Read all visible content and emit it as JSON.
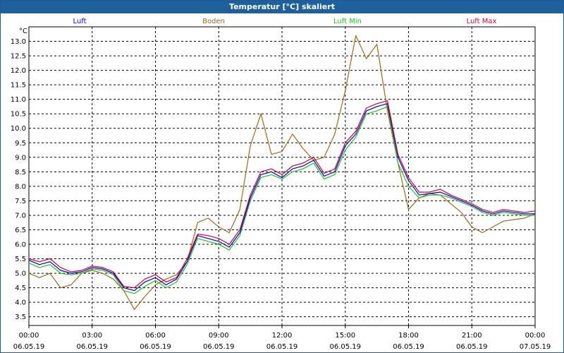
{
  "window": {
    "title": "Temperatur [°C] skaliert"
  },
  "chart_data": {
    "type": "line",
    "title": "Temperatur [°C] skaliert",
    "ylabel": "°C",
    "xlabel": "",
    "ylim": [
      3.2,
      13.5
    ],
    "xlim": [
      0,
      24
    ],
    "yticks": [
      "3.5",
      "4.0",
      "4.5",
      "5.0",
      "5.5",
      "6.0",
      "6.5",
      "7.0",
      "7.5",
      "8.0",
      "8.5",
      "9.0",
      "9.5",
      "10.0",
      "10.5",
      "11.0",
      "11.5",
      "12.0",
      "12.5",
      "13.0"
    ],
    "xticks": [
      {
        "time": "00:00",
        "date": "06.05.19"
      },
      {
        "time": "03:00",
        "date": "06.05.19"
      },
      {
        "time": "06:00",
        "date": "06.05.19"
      },
      {
        "time": "09:00",
        "date": "06.05.19"
      },
      {
        "time": "12:00",
        "date": "06.05.19"
      },
      {
        "time": "15:00",
        "date": "06.05.19"
      },
      {
        "time": "18:00",
        "date": "06.05.19"
      },
      {
        "time": "21:00",
        "date": "06.05.19"
      },
      {
        "time": "00:00",
        "date": "07.05.19"
      }
    ],
    "grid": true,
    "legend_position": "top",
    "series": [
      {
        "name": "Luft",
        "color": "#0000cc",
        "x": [
          0,
          0.5,
          1,
          1.5,
          2,
          2.5,
          3,
          3.5,
          4,
          4.5,
          5,
          5.5,
          6,
          6.5,
          7,
          7.5,
          8,
          8.5,
          9,
          9.5,
          10,
          10.5,
          11,
          11.5,
          12,
          12.5,
          13,
          13.5,
          14,
          14.5,
          15,
          15.5,
          16,
          16.5,
          17,
          17.5,
          18,
          18.5,
          19,
          19.5,
          20,
          20.5,
          21,
          21.5,
          22,
          22.5,
          23,
          23.5,
          24
        ],
        "y": [
          5.45,
          5.3,
          5.4,
          5.1,
          5.0,
          5.05,
          5.2,
          5.15,
          5.0,
          4.5,
          4.4,
          4.7,
          4.85,
          4.6,
          4.8,
          5.4,
          6.3,
          6.2,
          6.1,
          5.9,
          6.4,
          7.6,
          8.4,
          8.5,
          8.3,
          8.6,
          8.7,
          8.9,
          8.35,
          8.5,
          9.4,
          9.8,
          10.6,
          10.75,
          10.85,
          9.0,
          8.2,
          7.7,
          7.75,
          7.8,
          7.65,
          7.5,
          7.35,
          7.15,
          7.05,
          7.15,
          7.1,
          7.05,
          7.05
        ]
      },
      {
        "name": "Boden",
        "color": "#a0661a",
        "x": [
          0,
          0.5,
          1,
          1.5,
          2,
          2.5,
          3,
          3.5,
          4,
          4.5,
          5,
          5.5,
          6,
          6.5,
          7,
          7.5,
          8,
          8.5,
          9,
          9.5,
          10,
          10.5,
          11,
          11.5,
          12,
          12.5,
          13,
          13.5,
          14,
          14.5,
          15,
          15.5,
          16,
          16.5,
          17,
          17.5,
          18,
          18.5,
          19,
          19.5,
          20,
          20.5,
          21,
          21.5,
          22,
          22.5,
          23,
          23.5,
          24
        ],
        "y": [
          5.0,
          4.85,
          5.0,
          4.5,
          4.6,
          5.0,
          5.1,
          5.0,
          4.8,
          4.4,
          3.75,
          4.2,
          4.6,
          4.8,
          4.95,
          5.4,
          6.75,
          6.9,
          6.6,
          6.4,
          7.2,
          9.4,
          10.5,
          9.1,
          9.2,
          9.8,
          9.3,
          8.9,
          9.0,
          9.8,
          11.3,
          13.2,
          12.4,
          12.9,
          10.6,
          8.8,
          7.2,
          7.6,
          7.75,
          7.7,
          7.4,
          7.1,
          6.6,
          6.4,
          6.6,
          6.8,
          6.85,
          6.9,
          7.05
        ]
      },
      {
        "name": "Luft Min",
        "color": "#1fc31f",
        "x": [
          0,
          0.5,
          1,
          1.5,
          2,
          2.5,
          3,
          3.5,
          4,
          4.5,
          5,
          5.5,
          6,
          6.5,
          7,
          7.5,
          8,
          8.5,
          9,
          9.5,
          10,
          10.5,
          11,
          11.5,
          12,
          12.5,
          13,
          13.5,
          14,
          14.5,
          15,
          15.5,
          16,
          16.5,
          17,
          17.5,
          18,
          18.5,
          19,
          19.5,
          20,
          20.5,
          21,
          21.5,
          22,
          22.5,
          23,
          23.5,
          24
        ],
        "y": [
          5.35,
          5.2,
          5.3,
          5.0,
          4.95,
          5.0,
          5.15,
          5.1,
          4.95,
          4.4,
          4.3,
          4.55,
          4.75,
          4.5,
          4.7,
          5.3,
          6.2,
          6.1,
          6.0,
          5.8,
          6.3,
          7.5,
          8.3,
          8.4,
          8.25,
          8.5,
          8.6,
          8.8,
          8.25,
          8.4,
          9.25,
          9.7,
          10.5,
          10.6,
          10.75,
          8.8,
          8.0,
          7.6,
          7.7,
          7.7,
          7.6,
          7.45,
          7.3,
          7.1,
          7.0,
          7.1,
          7.05,
          7.0,
          7.0
        ]
      },
      {
        "name": "Luft Max",
        "color": "#cc0033",
        "x": [
          0,
          0.5,
          1,
          1.5,
          2,
          2.5,
          3,
          3.5,
          4,
          4.5,
          5,
          5.5,
          6,
          6.5,
          7,
          7.5,
          8,
          8.5,
          9,
          9.5,
          10,
          10.5,
          11,
          11.5,
          12,
          12.5,
          13,
          13.5,
          14,
          14.5,
          15,
          15.5,
          16,
          16.5,
          17,
          17.5,
          18,
          18.5,
          19,
          19.5,
          20,
          20.5,
          21,
          21.5,
          22,
          22.5,
          23,
          23.5,
          24
        ],
        "y": [
          5.5,
          5.4,
          5.5,
          5.2,
          5.05,
          5.1,
          5.25,
          5.2,
          5.05,
          4.55,
          4.5,
          4.8,
          4.95,
          4.7,
          4.85,
          5.5,
          6.35,
          6.3,
          6.2,
          6.0,
          6.5,
          7.7,
          8.5,
          8.6,
          8.4,
          8.7,
          8.8,
          9.0,
          8.45,
          8.6,
          9.5,
          9.9,
          10.7,
          10.85,
          10.95,
          9.1,
          8.3,
          7.8,
          7.8,
          7.9,
          7.7,
          7.55,
          7.4,
          7.2,
          7.1,
          7.2,
          7.15,
          7.1,
          7.15
        ]
      }
    ]
  }
}
